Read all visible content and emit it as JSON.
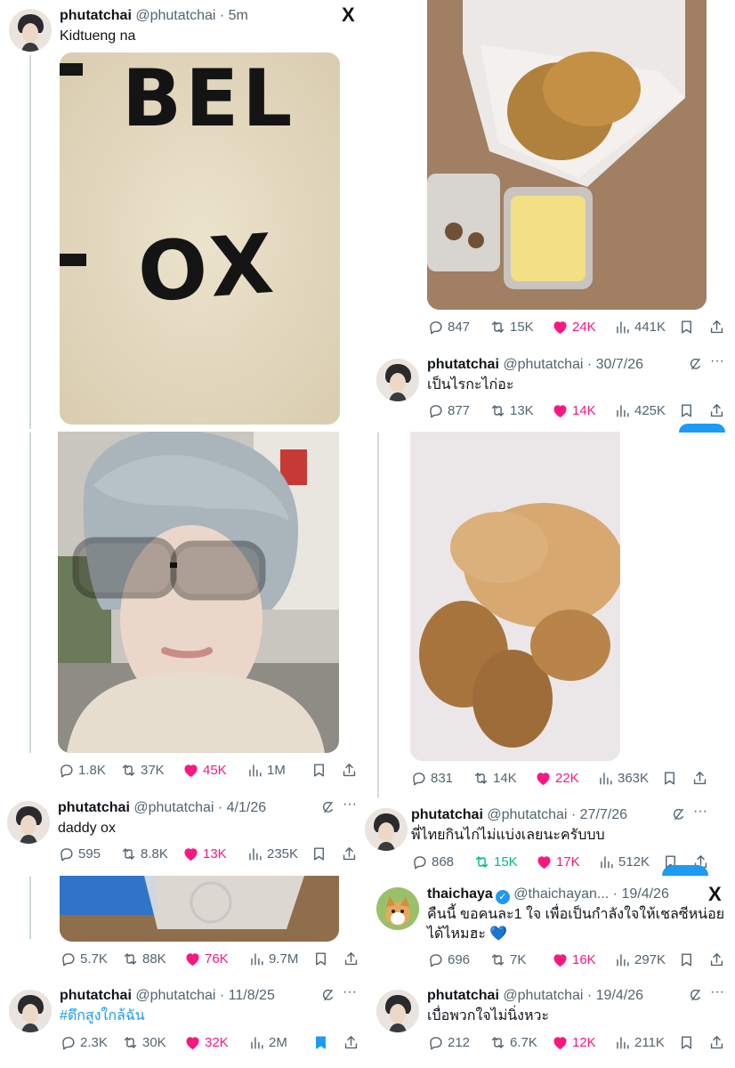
{
  "colors": {
    "accent": "#1d9bf0",
    "like": "#f91880",
    "retweet": "#00ba7c",
    "muted": "#536471"
  },
  "tweets": [
    {
      "name": "phutatchai",
      "handle": "@phutatchai",
      "time": "5m",
      "text": "Kidtueng na",
      "brand": "X"
    },
    {
      "name": "phutatchai",
      "handle": "@phutatchai",
      "time": "30/7/26",
      "text": "เป็นไรกะไก่อะ"
    },
    {
      "name": "phutatchai",
      "handle": "@phutatchai",
      "time": "4/1/26",
      "text": "daddy ox"
    },
    {
      "name": "phutatchai",
      "handle": "@phutatchai",
      "time": "27/7/26",
      "text": "พี่ไทยกินไก่ไม่แบ่งเลยนะครับบบ"
    },
    {
      "name": "thaichaya",
      "handle": "@thaichayan...",
      "time": "19/4/26",
      "text_line1": "คืนนี้ ขอคนละ1 ใจ เพื่อเป็นกำลังใจให้เชลซีหน่อย",
      "text_line2": "ได้ไหมฮะ",
      "emoji": "💙",
      "brand": "X"
    },
    {
      "name": "phutatchai",
      "handle": "@phutatchai",
      "time": "11/8/25",
      "text": "#ตึกสูงใกล้ฉัน"
    },
    {
      "name": "phutatchai",
      "handle": "@phutatchai",
      "time": "19/4/26",
      "text": "เบื่อพวกใจไม่นิ่งหวะ"
    }
  ],
  "stats": {
    "r1": {
      "replies": "847",
      "reposts": "15K",
      "likes": "24K",
      "views": "441K"
    },
    "r2": {
      "replies": "877",
      "reposts": "13K",
      "likes": "14K",
      "views": "425K"
    },
    "l1": {
      "replies": "1.8K",
      "reposts": "37K",
      "likes": "45K",
      "views": "1M"
    },
    "l2": {
      "replies": "595",
      "reposts": "8.8K",
      "likes": "13K",
      "views": "235K"
    },
    "r3": {
      "replies": "831",
      "reposts": "14K",
      "likes": "22K",
      "views": "363K"
    },
    "r4": {
      "replies": "868",
      "reposts": "15K",
      "likes": "17K",
      "views": "512K"
    },
    "l3": {
      "replies": "5.7K",
      "reposts": "88K",
      "likes": "76K",
      "views": "9.7M"
    },
    "r5": {
      "replies": "696",
      "reposts": "7K",
      "likes": "16K",
      "views": "297K"
    },
    "l4": {
      "replies": "2.3K",
      "reposts": "30K",
      "likes": "32K",
      "views": "2M"
    },
    "r6": {
      "replies": "212",
      "reposts": "6.7K",
      "likes": "12K",
      "views": "211K"
    }
  },
  "media_text": {
    "line1": "BEL",
    "line2": "OX"
  },
  "icons": {
    "reply": "reply-icon",
    "repost": "repost-icon",
    "like": "heart-icon",
    "views": "views-icon",
    "bookmark": "bookmark-icon",
    "share": "share-icon",
    "grok": "grok-icon",
    "more": "more-icon",
    "brand": "x-logo-icon"
  }
}
